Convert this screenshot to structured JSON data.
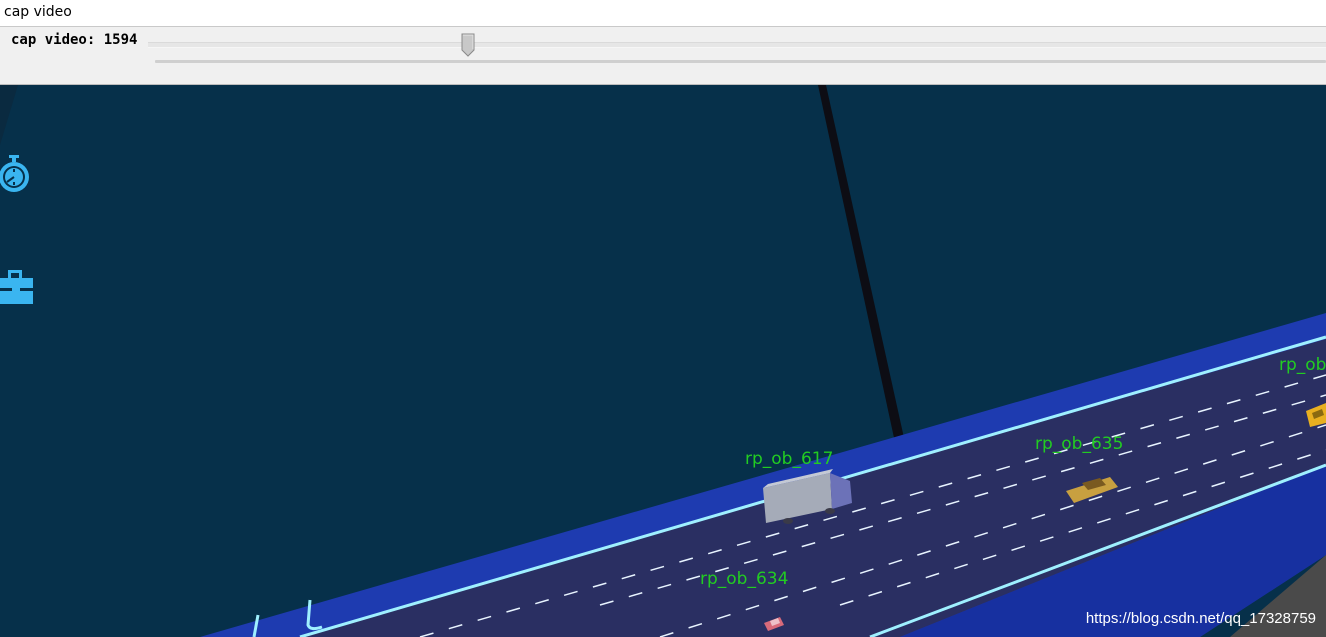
{
  "window": {
    "title": "cap video"
  },
  "trackbar": {
    "label": "cap video: 1594",
    "value": 1594,
    "position_fraction": 0.27
  },
  "toolbar_icons": [
    {
      "name": "stopwatch-icon",
      "color": "#3ab5f0"
    },
    {
      "name": "toolbox-icon",
      "color": "#3ab5f0"
    }
  ],
  "scene": {
    "background_color": "#06304a",
    "road_color": "#2a2f62",
    "road_border_color": "#1e3bb0",
    "lane_line_color": "#e8f4ff",
    "label_color": "#22cc22",
    "objects": [
      {
        "label": "rp_ob_617",
        "type": "truck",
        "color": "#9aa0b0"
      },
      {
        "label": "rp_ob_635",
        "type": "car",
        "color": "#c8a040"
      },
      {
        "label": "rp_ob_634",
        "type": "car",
        "color": "#d86a7a"
      },
      {
        "label": "rp_ob",
        "type": "car",
        "color": "#e8b020"
      }
    ]
  },
  "watermark": "https://blog.csdn.net/qq_17328759"
}
